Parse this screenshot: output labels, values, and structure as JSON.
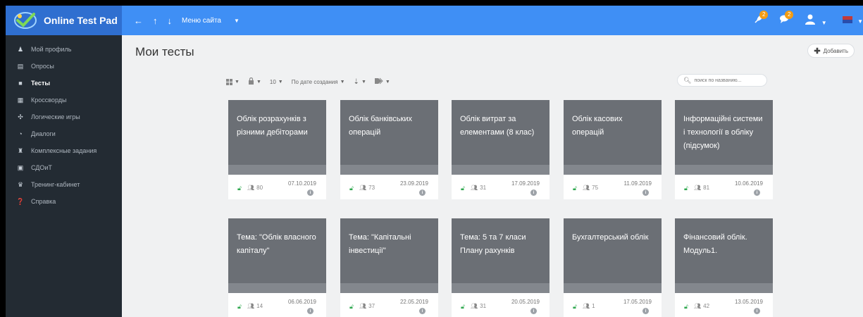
{
  "app": {
    "title": "Online Test Pad",
    "site_menu": "Меню сайта"
  },
  "topbar": {
    "notifications_count": "2",
    "messages_count": "2"
  },
  "sidebar": {
    "items": [
      {
        "label": "Мой профиль",
        "icon": "user-icon",
        "active": false
      },
      {
        "label": "Опросы",
        "icon": "poll-icon",
        "active": false
      },
      {
        "label": "Тесты",
        "icon": "test-icon",
        "active": true
      },
      {
        "label": "Кроссворды",
        "icon": "crossword-icon",
        "active": false
      },
      {
        "label": "Логические игры",
        "icon": "puzzle-icon",
        "active": false
      },
      {
        "label": "Диалоги",
        "icon": "dialog-icon",
        "active": false
      },
      {
        "label": "Комплексные задания",
        "icon": "complex-task-icon",
        "active": false
      },
      {
        "label": "СДОиТ",
        "icon": "sdoit-icon",
        "active": false
      },
      {
        "label": "Тренинг-кабинет",
        "icon": "training-icon",
        "active": false
      },
      {
        "label": "Справка",
        "icon": "help-icon",
        "active": false
      }
    ]
  },
  "main": {
    "title": "Мои тесты",
    "add_button": "Добавить",
    "toolbar": {
      "per_page": "10",
      "sort": "По дате создания"
    },
    "search": {
      "placeholder": "поиск по названию..."
    },
    "cards": [
      {
        "title": "Облік розрахунків з різними дебіторами",
        "users": "80",
        "date": "07.10.2019"
      },
      {
        "title": "Облік банківських операцій",
        "users": "73",
        "date": "23.09.2019"
      },
      {
        "title": "Облік витрат за елементами (8 клас)",
        "users": "31",
        "date": "17.09.2019"
      },
      {
        "title": "Облік касових операцій",
        "users": "75",
        "date": "11.09.2019"
      },
      {
        "title": "Інформаційні системи і технології в обліку (підсумок)",
        "users": "81",
        "date": "10.06.2019"
      },
      {
        "title": "Тема: \"Облік власного капіталу\"",
        "users": "14",
        "date": "06.06.2019"
      },
      {
        "title": "Тема: \"Капітальні інвестиції\"",
        "users": "37",
        "date": "22.05.2019"
      },
      {
        "title": "Тема: 5 та 7 класи Плану рахунків",
        "users": "31",
        "date": "20.05.2019"
      },
      {
        "title": "Бухгалтерський облік",
        "users": "1",
        "date": "17.05.2019"
      },
      {
        "title": "Фінансовий облік. Модуль1.",
        "users": "42",
        "date": "13.05.2019"
      }
    ]
  },
  "colors": {
    "topbar": "#3f8ff5",
    "sidebar": "#232b33",
    "card": "#6b6f75",
    "lock_open": "#2fa84f"
  }
}
